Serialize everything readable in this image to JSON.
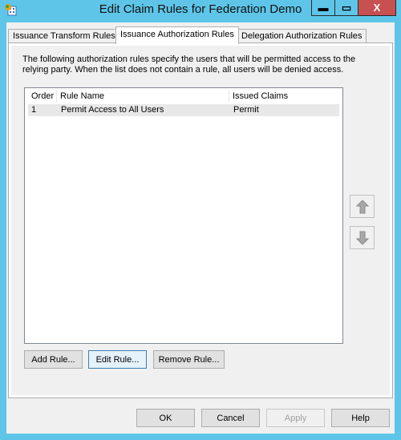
{
  "window": {
    "title": "Edit Claim Rules for Federation Demo",
    "controls": {
      "minimize": "▬",
      "maximize": "▭",
      "close": "X"
    }
  },
  "tabs": [
    {
      "label": "Issuance Transform Rules",
      "active": false
    },
    {
      "label": "Issuance Authorization Rules",
      "active": true
    },
    {
      "label": "Delegation Authorization Rules",
      "active": false
    }
  ],
  "panel": {
    "description": "The following authorization rules specify the users that will be permitted access to the relying party. When the list does not contain a rule, all users will be denied access.",
    "columns": [
      "Order",
      "Rule Name",
      "Issued Claims"
    ],
    "rows": [
      {
        "order": "1",
        "rule_name": "Permit Access to All Users",
        "issued_claims": "Permit"
      }
    ],
    "move_up_icon": "arrow-up-icon",
    "move_down_icon": "arrow-down-icon",
    "add_rule": "Add Rule...",
    "edit_rule": "Edit Rule...",
    "remove_rule": "Remove Rule..."
  },
  "footer": {
    "ok": "OK",
    "cancel": "Cancel",
    "apply": "Apply",
    "help": "Help"
  }
}
